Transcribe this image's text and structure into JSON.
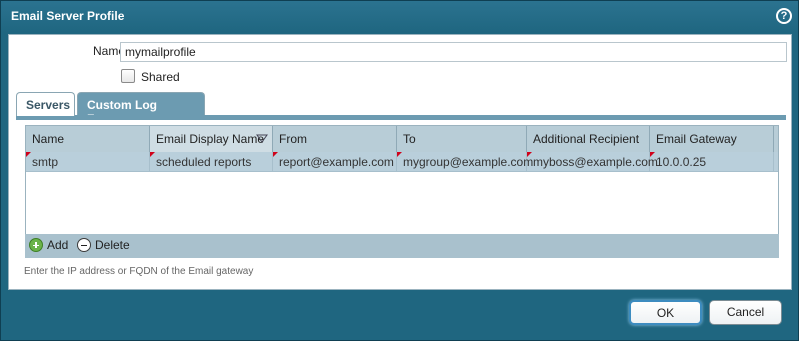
{
  "dialog": {
    "title": "Email Server Profile",
    "help_icon": "help-icon",
    "help_glyph": "?"
  },
  "form": {
    "name_label": "Name",
    "name_value": "mymailprofile",
    "shared_label": "Shared",
    "shared_checked": false
  },
  "tabs": [
    {
      "label": "Servers",
      "active": true
    },
    {
      "label": "Custom Log Format",
      "active": false
    }
  ],
  "table": {
    "columns": [
      "Name",
      "Email Display Name",
      "From",
      "To",
      "Additional Recipient",
      "Email Gateway"
    ],
    "sorted_column": "Email Display Name",
    "rows": [
      [
        "smtp",
        "scheduled reports",
        "report@example.com",
        "mygroup@example.com",
        "myboss@example.com",
        "10.0.0.25"
      ]
    ]
  },
  "toolbar": {
    "add_label": "Add",
    "delete_label": "Delete"
  },
  "hint": "Enter the IP address or FQDN of the Email gateway",
  "buttons": {
    "ok_label": "OK",
    "cancel_label": "Cancel"
  },
  "colors": {
    "titlebar": "#1f6680",
    "tab_inactive": "#6c9bb1",
    "row_selected": "#b9cfdb"
  }
}
